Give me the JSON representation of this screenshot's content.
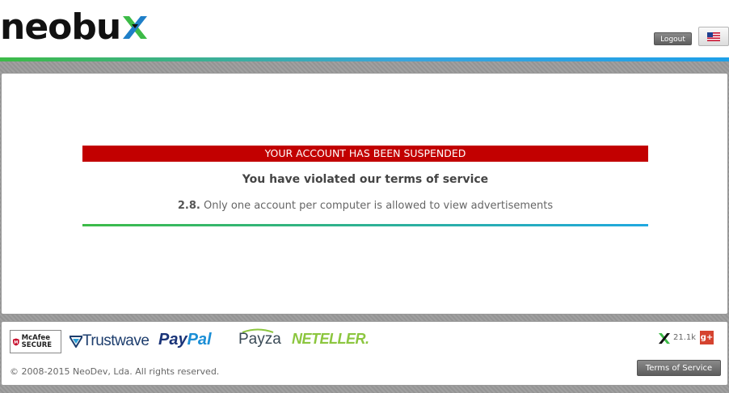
{
  "header": {
    "logo_text": "neobu",
    "logout_label": "Logout",
    "language_flag": "us-flag-icon"
  },
  "notice": {
    "banner": "YOUR ACCOUNT HAS BEEN SUSPENDED",
    "headline": "You have violated our terms of service",
    "rule_number": "2.8.",
    "rule_text": "Only one account per computer is allowed to view advertisements"
  },
  "footer": {
    "badges": {
      "mcafee": "McAfee SECURE",
      "trustwave": "Trustwave",
      "paypal_1": "Pay",
      "paypal_2": "Pal",
      "payza": "Payza",
      "neteller": "NETELLER."
    },
    "follower_count": "21.1k",
    "gplus": "g+",
    "copyright": "© 2008-2015 NeoDev, Lda. All rights reserved.",
    "tos_label": "Terms of Service"
  },
  "colors": {
    "accent_green": "#3cbb47",
    "accent_blue": "#20a8e0",
    "alert_red": "#c20000"
  }
}
